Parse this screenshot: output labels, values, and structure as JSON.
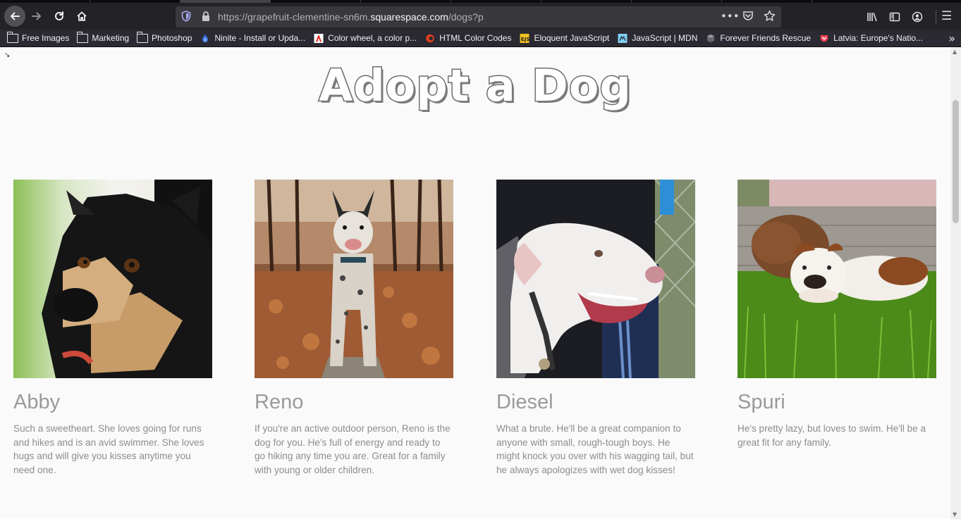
{
  "browser": {
    "url_prefix": "https://grapefruit-clementine-sn6m.",
    "url_domain": "squarespace.com",
    "url_suffix": "/dogs?p",
    "bookmarks": [
      {
        "label": "Free Images",
        "icon": "folder-icon"
      },
      {
        "label": "Marketing",
        "icon": "folder-icon"
      },
      {
        "label": "Photoshop",
        "icon": "folder-icon"
      },
      {
        "label": "Ninite - Install or Upda...",
        "icon": "ninite-icon"
      },
      {
        "label": "Color wheel, a color p...",
        "icon": "adobe-icon"
      },
      {
        "label": "HTML Color Codes",
        "icon": "color-codes-icon"
      },
      {
        "label": "Eloquent JavaScript",
        "icon": "ejs-icon"
      },
      {
        "label": "JavaScript | MDN",
        "icon": "mdn-icon"
      },
      {
        "label": "Forever Friends Rescue",
        "icon": "cube-icon"
      },
      {
        "label": "Latvia: Europe's Natio...",
        "icon": "pocket-icon"
      }
    ]
  },
  "page": {
    "title": "Adopt a Dog",
    "dogs": [
      {
        "name": "Abby",
        "description": "Such a sweetheart. She loves going for runs and hikes and is an avid swimmer. She loves hugs and will give you kisses anytime you need one."
      },
      {
        "name": "Reno",
        "description": "If you're an active outdoor person, Reno is the dog for you. He's full of energy and ready to go hiking any time you are. Great for a family with young or older children."
      },
      {
        "name": "Diesel",
        "description": "What a brute. He'll be a great companion to anyone with small, rough-tough boys. He might knock you over with his wagging tail, but he always apologizes with wet dog kisses!"
      },
      {
        "name": "Spuri",
        "description": "He's pretty lazy, but loves to swim. He'll be a great fit for any family."
      }
    ]
  },
  "colors": {
    "chrome_dark": "#232327",
    "url_bg": "#38383d",
    "bookmarks_bg": "#2b2a33",
    "page_bg": "#fafafa",
    "dog_name": "#9a9a9a",
    "dog_text": "#8d8d8d"
  }
}
